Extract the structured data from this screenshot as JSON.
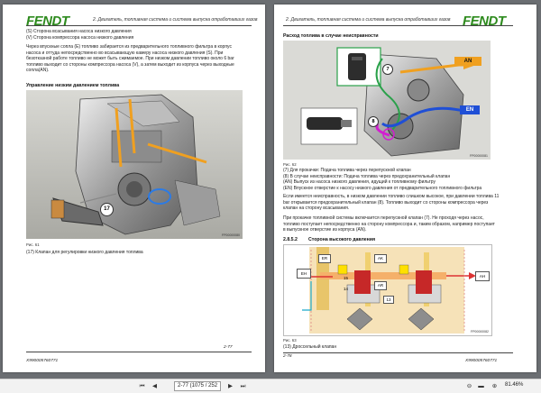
{
  "left": {
    "logo": "FENDT",
    "header": "2. Двигатель, топливная система и система выпуска отработавших газов",
    "lines": [
      "(S)    Сторона всасывания насоса низкого давления",
      "(V)    Сторона компрессора насоса низкого давления"
    ],
    "paragraph": [
      "Через впускные сопла (E) топливо забирается из предварительного топливного фильтра в корпус",
      "насоса и оттуда непосредственно во всасывающую камеру насоса низкого давления (S). При",
      "безотказной работе топливо не может быть сжимаемое. При низком давлении топливо около 6 bar",
      "топливо выходит со стороны компрессора насоса (V), а затем выходит из корпуса через выходные",
      "сопла(AN)."
    ],
    "section_title": "Управление низким давлением топлива",
    "callout_17": "17",
    "fig_label": "Рис. 61",
    "legend": "(17)   Клапан для регулировки низкого давления топлива",
    "fig_code": "FP00000080",
    "page_num": "2-77",
    "doc_code": "X990005760771"
  },
  "right": {
    "logo": "FENDT",
    "header": "2. Двигатель, топливная система и система выпуска отработавших газов",
    "section_title": "Расход топлива в случае неисправности",
    "labels": {
      "an": "AN",
      "en": "EN",
      "c7": "7",
      "c8": "8"
    },
    "fig_label": "Рис. 62",
    "legend": [
      "(7)    Для прокачки: Подача топлива через перепускной клапан",
      "(8)    В случае неисправности: Подача топлива через предохранительный клапан",
      "(AN)   Выпуск из насоса низкого давления, идущий к топливному фильтру",
      "(EN)   Впускное отверстие к насосу низкого давления от предварительного топливного фильтра"
    ],
    "para1": [
      "Если имеется неисправность, в низком давлении топливо слишком высокое, при давлении топлива 11",
      "bar открывается предохранительный клапан (8). Топливо выходит со стороны компрессора через",
      "клапан на сторону всасывания."
    ],
    "para2": [
      "При прокачке топливной системы включается перепускной клапан (7). Не проходя через насос,",
      "топливо поступает непосредственно на сторону компрессора и, таким образом, например поступает",
      "в выпускное отверстие из корпуса (AN)."
    ],
    "section2_num": "2.8.5.2",
    "section2_title": "Сторона высокого давления",
    "diagram": {
      "eh": "EH",
      "er": "ER",
      "ak": "AK",
      "ar": "AR",
      "ah": "AH",
      "n15": "15",
      "n14": "14",
      "n13": "13"
    },
    "fig2_label": "Рис. 63",
    "legend2": "(13)   Дроссельный клапан",
    "fig_code1": "FP00000081",
    "fig_code2": "FP00000082",
    "page_num": "2-78",
    "doc_code": "X990005760771"
  },
  "toolbar": {
    "page_display": "2-77 (1075 / 252",
    "zoom": "81.46%"
  }
}
